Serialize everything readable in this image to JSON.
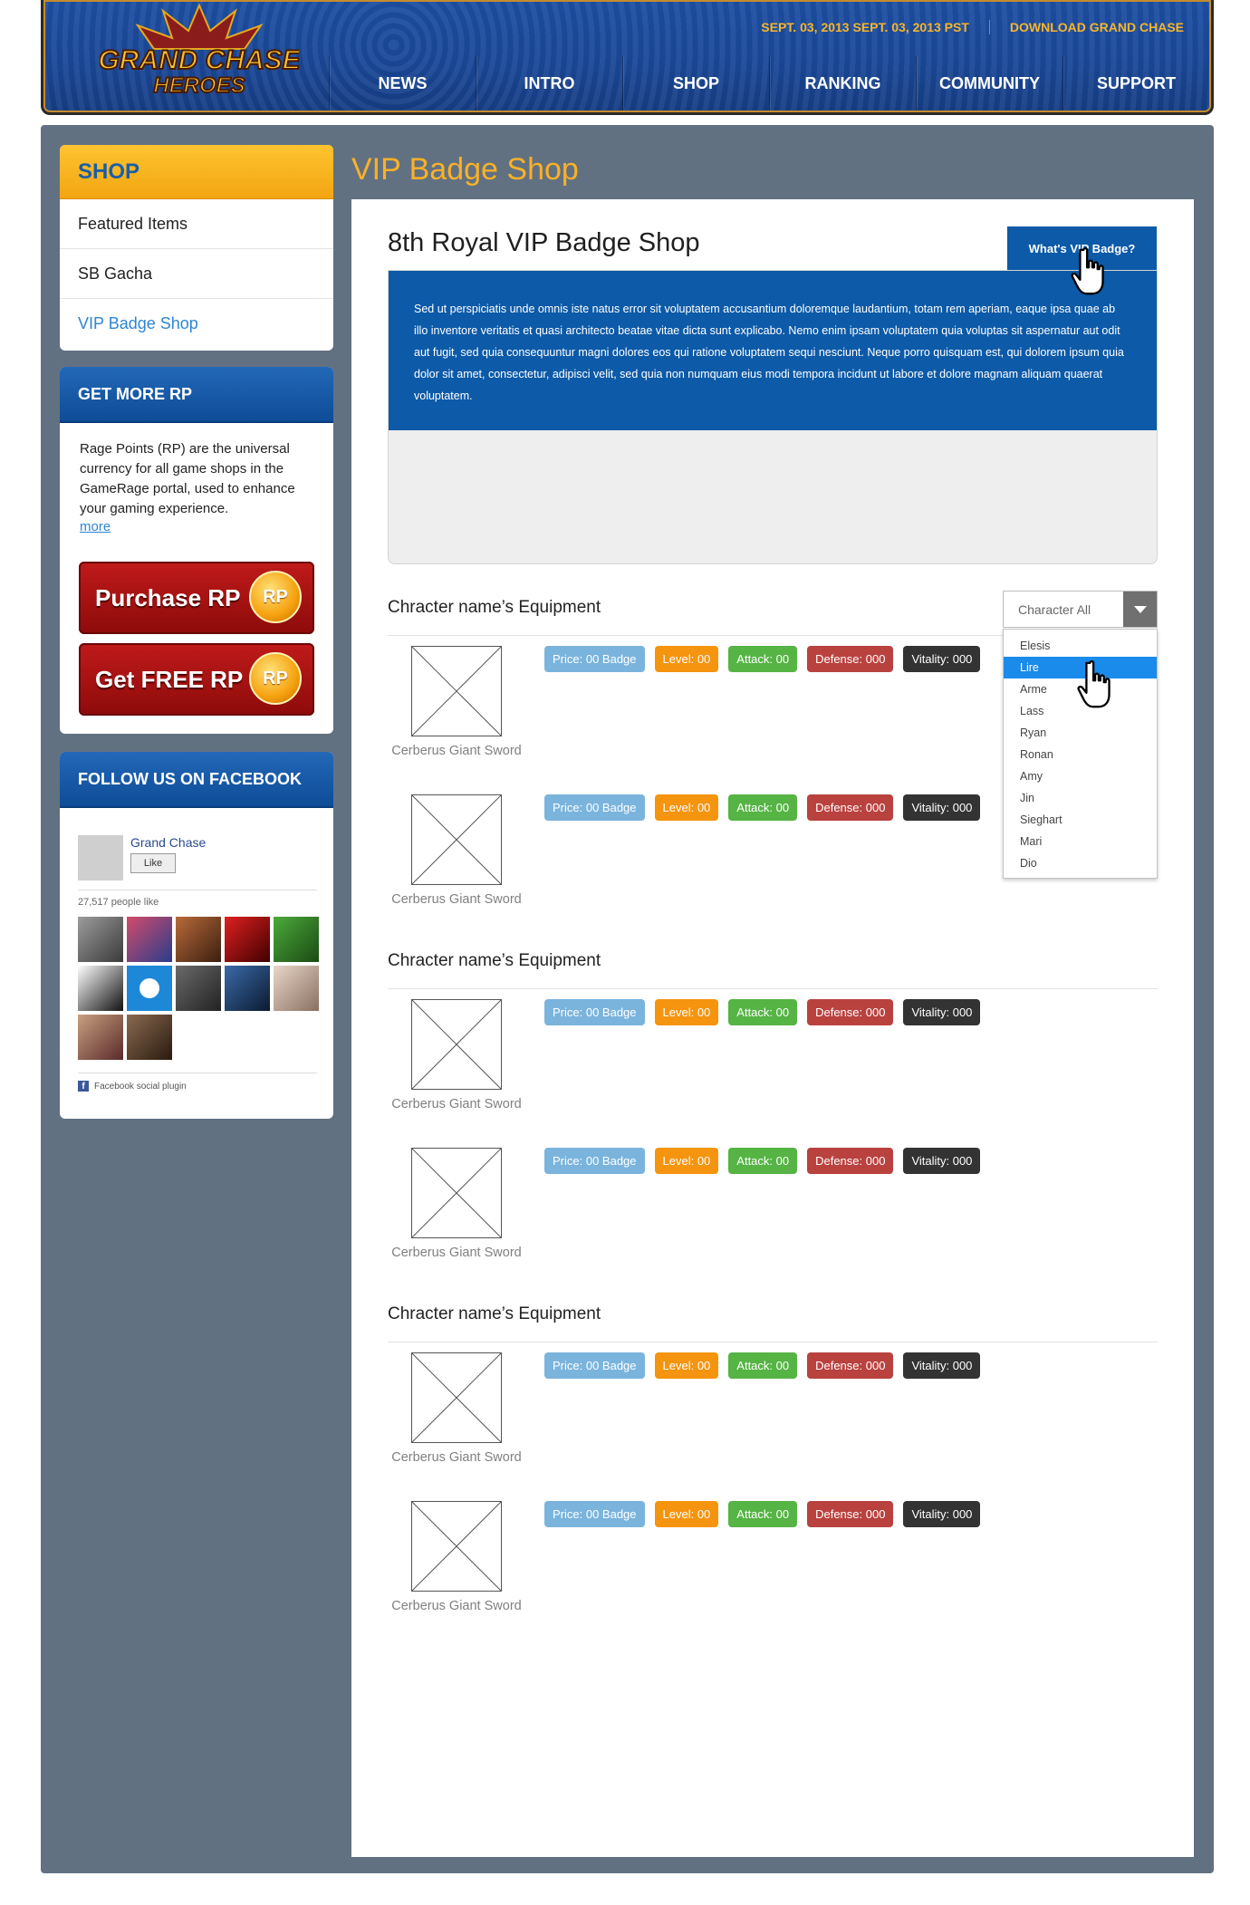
{
  "header": {
    "logo_text": "GRAND CHASE HEROES",
    "date_text": "SEPT. 03, 2013 SEPT. 03, 2013  PST",
    "download_label": "DOWNLOAD GRAND CHASE",
    "nav": [
      "NEWS",
      "INTRO",
      "SHOP",
      "RANKING",
      "COMMUNITY",
      "SUPPORT"
    ]
  },
  "sidebar": {
    "shop": {
      "title": "SHOP",
      "items": [
        "Featured Items",
        "SB Gacha",
        "VIP Badge Shop"
      ]
    },
    "rp": {
      "title": "GET MORE RP",
      "description": "Rage Points (RP) are the universal currency for all game shops in the GameRage portal, used to enhance your gaming experience.",
      "more_label": "more",
      "purchase_label": "Purchase RP",
      "free_label": "Get FREE RP",
      "coin_text": "RP"
    },
    "facebook": {
      "title": "FOLLOW US ON FACEBOOK",
      "page_name": "Grand Chase",
      "like_label": "Like",
      "people_like": "27,517 people like",
      "plugin_label": "Facebook social plugin",
      "fb_letter": "f"
    }
  },
  "main": {
    "page_title": "VIP Badge Shop",
    "shop_title": "8th Royal VIP Badge Shop",
    "vip_tab_label": "What's VIP Badge?",
    "intro_text": "Sed ut perspiciatis unde omnis iste natus error sit voluptatem accusantium doloremque laudantium, totam rem aperiam, eaque ipsa quae ab illo inventore veritatis et quasi architecto beatae vitae dicta sunt explicabo. Nemo enim ipsam voluptatem quia voluptas sit aspernatur aut odit aut fugit, sed quia consequuntur magni dolores eos qui ratione voluptatem sequi nesciunt. Neque porro quisquam est, qui dolorem ipsum quia dolor sit amet, consectetur, adipisci velit, sed quia non numquam eius modi tempora incidunt ut labore et dolore magnam aliquam quaerat voluptatem.",
    "character_filter": {
      "selected": "Character All",
      "options": [
        "Elesis",
        "Lire",
        "Arme",
        "Lass",
        "Ryan",
        "Ronan",
        "Amy",
        "Jin",
        "Sieghart",
        "Mari",
        "Dio"
      ],
      "highlighted": "Lire"
    },
    "sections": [
      {
        "title": "Chracter name’s Equipment",
        "items": [
          {
            "name": "Cerberus Giant Sword",
            "price": "Price: 00 Badge",
            "level": "Level: 00",
            "attack": "Attack: 00",
            "defense": "Defense: 000",
            "vitality": "Vitality: 000"
          },
          {
            "name": "Cerberus Giant Sword",
            "price": "Price: 00 Badge",
            "level": "Level: 00",
            "attack": "Attack: 00",
            "defense": "Defense: 000",
            "vitality": "Vitality: 000"
          }
        ]
      },
      {
        "title": "Chracter name’s Equipment",
        "items": [
          {
            "name": "Cerberus Giant Sword",
            "price": "Price: 00 Badge",
            "level": "Level: 00",
            "attack": "Attack: 00",
            "defense": "Defense: 000",
            "vitality": "Vitality: 000"
          },
          {
            "name": "Cerberus Giant Sword",
            "price": "Price: 00 Badge",
            "level": "Level: 00",
            "attack": "Attack: 00",
            "defense": "Defense: 000",
            "vitality": "Vitality: 000"
          }
        ]
      },
      {
        "title": "Chracter name’s Equipment",
        "items": [
          {
            "name": "Cerberus Giant Sword",
            "price": "Price: 00 Badge",
            "level": "Level: 00",
            "attack": "Attack: 00",
            "defense": "Defense: 000",
            "vitality": "Vitality: 000"
          },
          {
            "name": "Cerberus Giant Sword",
            "price": "Price: 00 Badge",
            "level": "Level: 00",
            "attack": "Attack: 00",
            "defense": "Defense: 000",
            "vitality": "Vitality: 000"
          }
        ]
      }
    ]
  },
  "colors": {
    "header_blue": "#1a4796",
    "accent_orange": "#f9b127",
    "frame_gray": "#627181",
    "intro_blue": "#0c5aa8",
    "link_blue": "#2d86d3",
    "select_highlight": "#1a8bea"
  },
  "icons": [
    "hand-pointer-cursor",
    "dropdown-caret-icon",
    "image-placeholder-icon",
    "rp-coin-icon",
    "facebook-icon"
  ]
}
